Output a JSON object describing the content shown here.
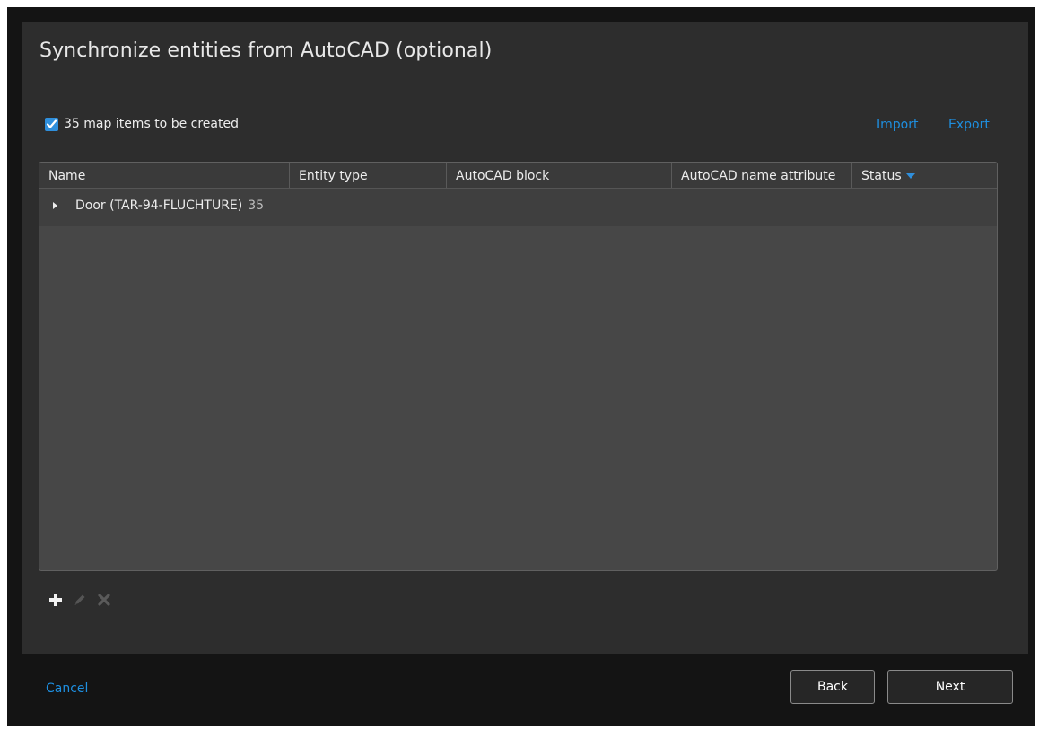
{
  "dialog": {
    "title": "Synchronize entities from AutoCAD (optional)"
  },
  "options": {
    "create_items_checked": true,
    "create_items_label": "35 map items to be created",
    "import_label": "Import",
    "export_label": "Export"
  },
  "grid": {
    "columns": [
      {
        "label": "Name"
      },
      {
        "label": "Entity type"
      },
      {
        "label": "AutoCAD block"
      },
      {
        "label": "AutoCAD name attribute"
      },
      {
        "label": "Status"
      }
    ],
    "groups": [
      {
        "name": "Door (TAR-94-FLUCHTURE)",
        "count": "35",
        "expanded": false
      }
    ]
  },
  "toolbar": {
    "add_icon": "plus-icon",
    "edit_icon": "pencil-icon",
    "delete_icon": "x-icon"
  },
  "footer": {
    "cancel_label": "Cancel",
    "back_label": "Back",
    "next_label": "Next"
  },
  "colors": {
    "accent": "#1e8fe0",
    "background": "#2d2d2d",
    "grid_background": "#474747"
  }
}
